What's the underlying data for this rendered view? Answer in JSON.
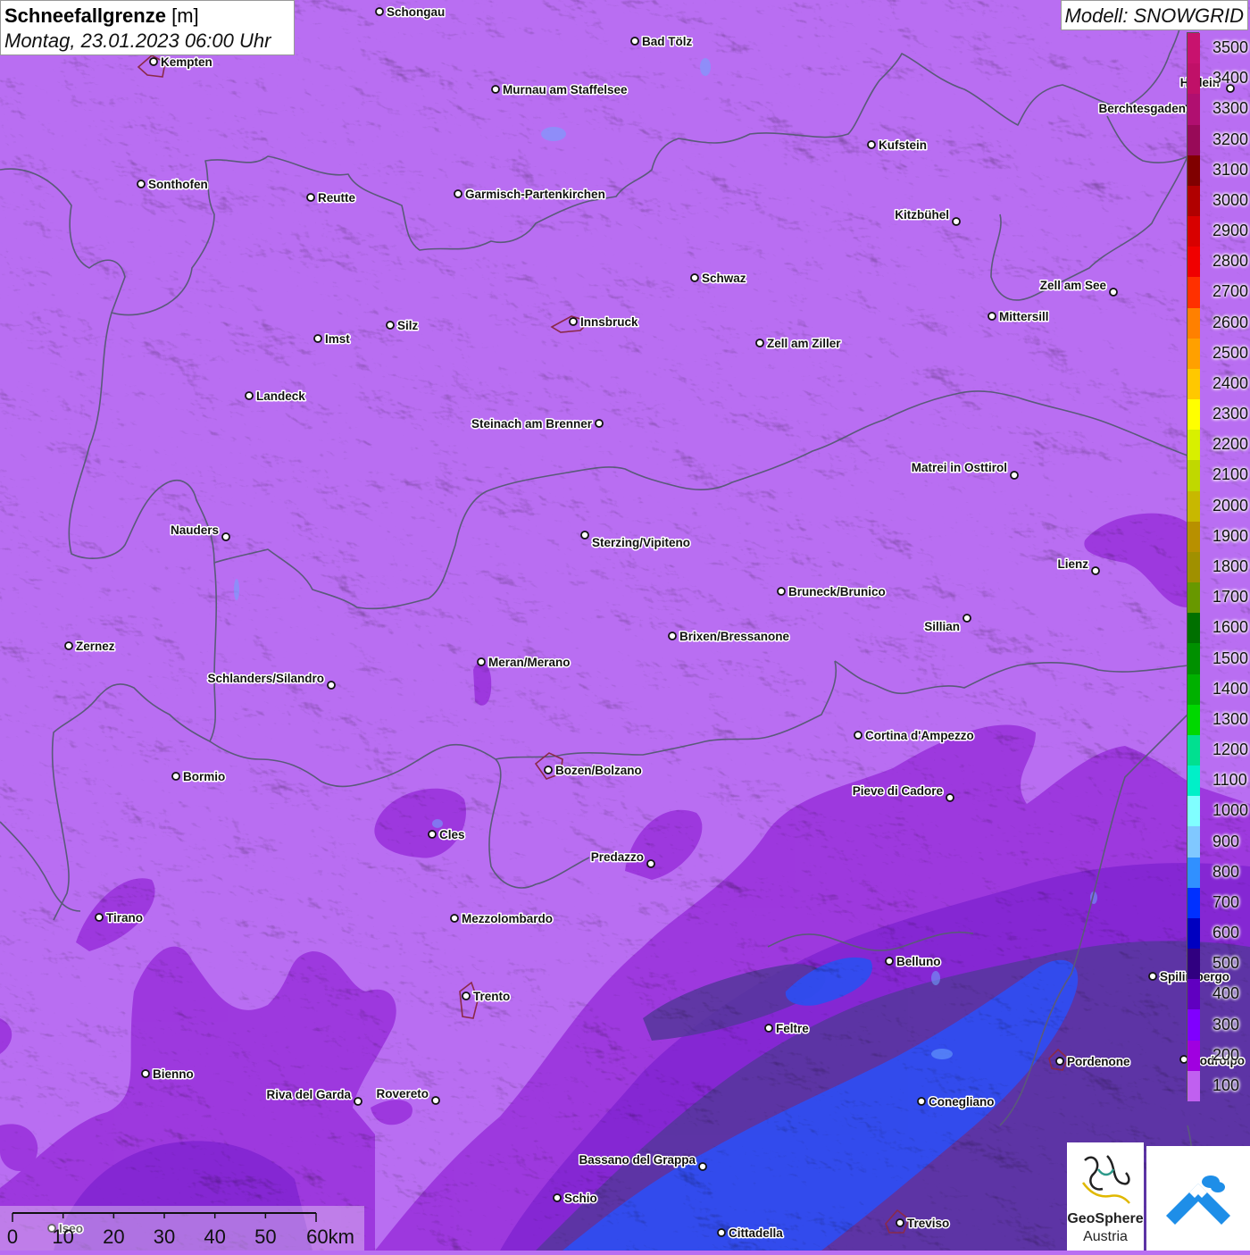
{
  "title": {
    "main": "Schneefallgrenze",
    "unit": "[m]",
    "datetime": "Montag, 23.01.2023 06:00 Uhr"
  },
  "model_label": "Modell: SNOWGRID",
  "legend": {
    "levels": [
      {
        "label": "3500",
        "color": "#c8126e"
      },
      {
        "label": "3400",
        "color": "#c01068"
      },
      {
        "label": "3300",
        "color": "#b00f70"
      },
      {
        "label": "3200",
        "color": "#980a58"
      },
      {
        "label": "3100",
        "color": "#800000"
      },
      {
        "label": "3000",
        "color": "#b00000"
      },
      {
        "label": "2900",
        "color": "#d80000"
      },
      {
        "label": "2800",
        "color": "#f00000"
      },
      {
        "label": "2700",
        "color": "#ff3000"
      },
      {
        "label": "2600",
        "color": "#ff8000"
      },
      {
        "label": "2500",
        "color": "#ffa000"
      },
      {
        "label": "2400",
        "color": "#ffc800"
      },
      {
        "label": "2300",
        "color": "#ffff00"
      },
      {
        "label": "2200",
        "color": "#d8f000"
      },
      {
        "label": "2100",
        "color": "#c0d800"
      },
      {
        "label": "2000",
        "color": "#c8b800"
      },
      {
        "label": "1900",
        "color": "#b89000"
      },
      {
        "label": "1800",
        "color": "#a09000"
      },
      {
        "label": "1700",
        "color": "#689800"
      },
      {
        "label": "1600",
        "color": "#007000"
      },
      {
        "label": "1500",
        "color": "#009000"
      },
      {
        "label": "1400",
        "color": "#00b000"
      },
      {
        "label": "1300",
        "color": "#00d800"
      },
      {
        "label": "1200",
        "color": "#00e090"
      },
      {
        "label": "1100",
        "color": "#00f0c8"
      },
      {
        "label": "1000",
        "color": "#80ffff"
      },
      {
        "label": "900",
        "color": "#80c8ff"
      },
      {
        "label": "800",
        "color": "#3090ff"
      },
      {
        "label": "700",
        "color": "#0030ff"
      },
      {
        "label": "600",
        "color": "#0000c0"
      },
      {
        "label": "500",
        "color": "#300080"
      },
      {
        "label": "400",
        "color": "#6000c0"
      },
      {
        "label": "300",
        "color": "#8000ff"
      },
      {
        "label": "200",
        "color": "#a000e0"
      },
      {
        "label": "100",
        "color": "#c060f0"
      }
    ]
  },
  "map_colors": {
    "base": "#b96ef2",
    "level_200": "#9a33dc",
    "level_300": "#8a2ad8",
    "level_500": "#5b3aa0",
    "level_700": "#2f4df0",
    "border": "#5a5a7a"
  },
  "cities": [
    {
      "name": "Schongau"
    },
    {
      "name": "Bad Tölz"
    },
    {
      "name": "Kempten"
    },
    {
      "name": "Murnau am Staffelsee"
    },
    {
      "name": "Hallein"
    },
    {
      "name": "Berchtesgaden"
    },
    {
      "name": "Kufstein"
    },
    {
      "name": "Sonthofen"
    },
    {
      "name": "Reutte"
    },
    {
      "name": "Garmisch-Partenkirchen"
    },
    {
      "name": "Kitzbühel"
    },
    {
      "name": "Schwaz"
    },
    {
      "name": "Zell am See"
    },
    {
      "name": "Mittersill"
    },
    {
      "name": "Innsbruck"
    },
    {
      "name": "Imst"
    },
    {
      "name": "Silz"
    },
    {
      "name": "Zell am Ziller"
    },
    {
      "name": "Landeck"
    },
    {
      "name": "Steinach am Brenner"
    },
    {
      "name": "Matrei in Osttirol"
    },
    {
      "name": "Nauders"
    },
    {
      "name": "Sterzing/Vipiteno"
    },
    {
      "name": "Lienz"
    },
    {
      "name": "Bruneck/Brunico"
    },
    {
      "name": "Sillian"
    },
    {
      "name": "Brixen/Bressanone"
    },
    {
      "name": "Zernez"
    },
    {
      "name": "Meran/Merano"
    },
    {
      "name": "Schlanders/Silandro"
    },
    {
      "name": "Cortina d'Ampezzo"
    },
    {
      "name": "Bozen/Bolzano"
    },
    {
      "name": "Bormio"
    },
    {
      "name": "Pieve di Cadore"
    },
    {
      "name": "Cles"
    },
    {
      "name": "Predazzo"
    },
    {
      "name": "Tirano"
    },
    {
      "name": "Mezzolombardo"
    },
    {
      "name": "Belluno"
    },
    {
      "name": "Spilimbergo"
    },
    {
      "name": "Trento"
    },
    {
      "name": "Feltre"
    },
    {
      "name": "Pordenone"
    },
    {
      "name": "Codroipo"
    },
    {
      "name": "Bienno"
    },
    {
      "name": "Riva del Garda"
    },
    {
      "name": "Rovereto"
    },
    {
      "name": "Conegliano"
    },
    {
      "name": "Bassano del Grappa"
    },
    {
      "name": "Schio"
    },
    {
      "name": "Treviso"
    },
    {
      "name": "Cittadella"
    },
    {
      "name": "Iseo"
    }
  ],
  "scale_bar": {
    "labels": [
      "0",
      "10",
      "20",
      "30",
      "40",
      "50",
      "60km"
    ]
  },
  "logos": {
    "geosphere_name": "GeoSphere",
    "geosphere_country": "Austria"
  }
}
